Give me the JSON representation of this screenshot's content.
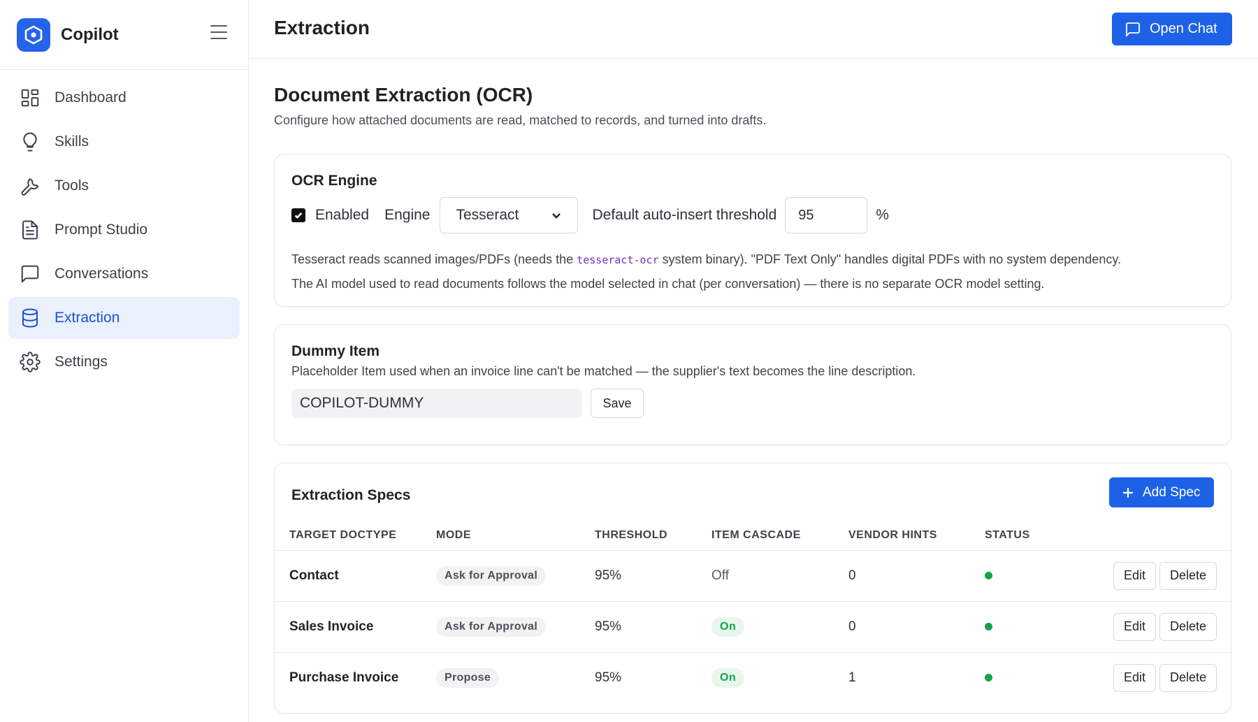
{
  "brand": {
    "name": "Copilot"
  },
  "sidebar": {
    "items": [
      {
        "label": "Dashboard",
        "icon": "dashboard-icon"
      },
      {
        "label": "Skills",
        "icon": "lightbulb-icon"
      },
      {
        "label": "Tools",
        "icon": "wrench-icon"
      },
      {
        "label": "Prompt Studio",
        "icon": "document-icon"
      },
      {
        "label": "Conversations",
        "icon": "chat-icon"
      },
      {
        "label": "Extraction",
        "icon": "database-icon",
        "active": true
      },
      {
        "label": "Settings",
        "icon": "gear-icon"
      }
    ]
  },
  "header": {
    "title": "Extraction",
    "open_chat_label": "Open Chat"
  },
  "page": {
    "title": "Document Extraction (OCR)",
    "subtitle": "Configure how attached documents are read, matched to records, and turned into drafts."
  },
  "ocr": {
    "title": "OCR Engine",
    "enabled_label": "Enabled",
    "enabled": true,
    "engine_label": "Engine",
    "engine_value": "Tesseract",
    "threshold_label": "Default auto-insert threshold",
    "threshold_value": "95",
    "percent": "%",
    "help1_a": "Tesseract reads scanned images/PDFs (needs the ",
    "help1_code": "tesseract-ocr",
    "help1_b": " system binary). \"PDF Text Only\" handles digital PDFs with no system dependency.",
    "help2": "The AI model used to read documents follows the model selected in chat (per conversation) — there is no separate OCR model setting."
  },
  "dummy": {
    "title": "Dummy Item",
    "subtitle": "Placeholder Item used when an invoice line can't be matched — the supplier's text becomes the line description.",
    "value": "COPILOT-DUMMY",
    "save_label": "Save"
  },
  "specs": {
    "title": "Extraction Specs",
    "add_label": "Add Spec",
    "columns": [
      "TARGET DOCTYPE",
      "MODE",
      "THRESHOLD",
      "ITEM CASCADE",
      "VENDOR HINTS",
      "STATUS"
    ],
    "rows": [
      {
        "doctype": "Contact",
        "mode": "Ask for Approval",
        "threshold": "95%",
        "cascade": "Off",
        "hints": "0",
        "status": "active"
      },
      {
        "doctype": "Sales Invoice",
        "mode": "Ask for Approval",
        "threshold": "95%",
        "cascade": "On",
        "hints": "0",
        "status": "active"
      },
      {
        "doctype": "Purchase Invoice",
        "mode": "Propose",
        "threshold": "95%",
        "cascade": "On",
        "hints": "1",
        "status": "active"
      }
    ],
    "edit_label": "Edit",
    "delete_label": "Delete"
  },
  "colors": {
    "accent": "#1d62e6",
    "active_bg": "#eaf1fd",
    "status_green": "#16a34a"
  }
}
